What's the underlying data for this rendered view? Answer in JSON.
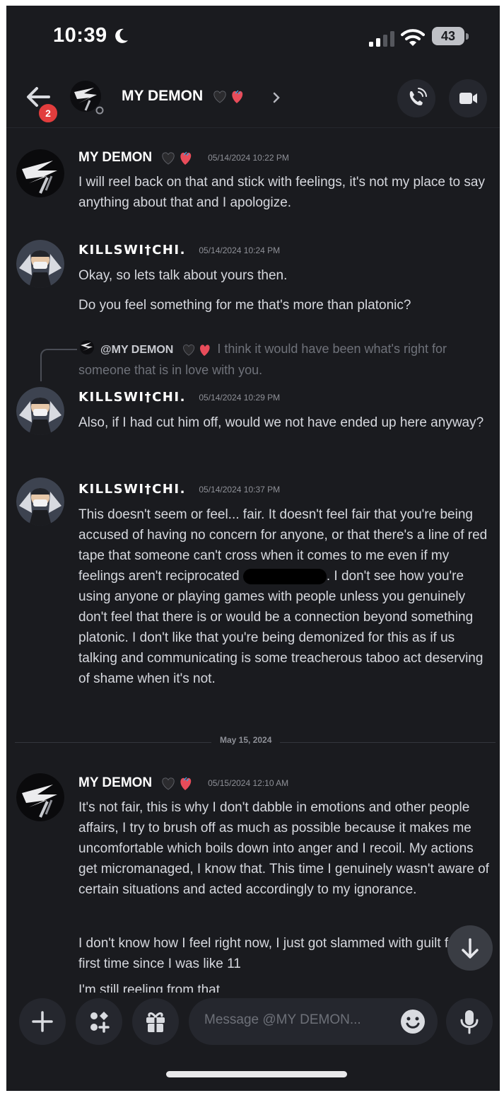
{
  "status_bar": {
    "time": "10:39",
    "battery": "43"
  },
  "header": {
    "title": "MY DEMON",
    "unread_badge": "2"
  },
  "messages": [
    {
      "author": "MY DEMON",
      "timestamp": "05/14/2024 10:22 PM",
      "lines": [
        "I will reel back on that and stick with feelings, it's not my place to say anything about that and I apologize."
      ]
    },
    {
      "author": "KILLSWI†CHI.",
      "timestamp": "05/14/2024 10:24 PM",
      "lines": [
        "Okay, so lets talk about yours then.",
        "Do you feel something for me that's more than platonic?"
      ]
    },
    {
      "reply_to": {
        "mention": "@MY DEMON",
        "preview": "I think it would have been what's right for someone that is in love with you."
      },
      "author": "KILLSWI†CHI.",
      "timestamp": "05/14/2024 10:29 PM",
      "lines": [
        "Also, if I had cut him off, would we not have ended up here anyway?"
      ]
    },
    {
      "author": "KILLSWI†CHI.",
      "timestamp": "05/14/2024 10:37 PM",
      "text_before_redaction": "This doesn't seem or feel... fair. It doesn't feel fair that you're being accused of having no concern for anyone, or that there's a line of red tape that someone can't cross when it comes to me even if my feelings aren't reciprocated",
      "text_after_redaction": ". I don't see how you're using anyone or playing games with people unless you genuinely don't feel that there is or would be a connection beyond something platonic. I don't like that you're being demonized for this as if us talking and communicating is some treacherous taboo act deserving of shame when it's not."
    },
    {
      "author": "MY DEMON",
      "timestamp": "05/15/2024 12:10 AM",
      "lines": [
        "It's not fair, this is why I don't dabble in emotions and other people affairs, I try to brush off as much as possible because it makes me uncomfortable which boils down into anger and I recoil. My actions get micromanaged, I know that. This time I genuinely wasn't aware of certain situations and acted accordingly to my ignorance.",
        "I don't know how I feel right now, I just got slammed with guilt for the first time since I was like 11",
        "I'm still reeling from that"
      ]
    }
  ],
  "date_divider": "May 15, 2024",
  "composer": {
    "placeholder": "Message @MY DEMON..."
  },
  "colors": {
    "background": "#1a1b1f",
    "surface": "#25272e",
    "badge": "#e23d3d",
    "text_primary": "#ffffff",
    "text_secondary": "#d6d8de",
    "muted": "#8e9097"
  }
}
